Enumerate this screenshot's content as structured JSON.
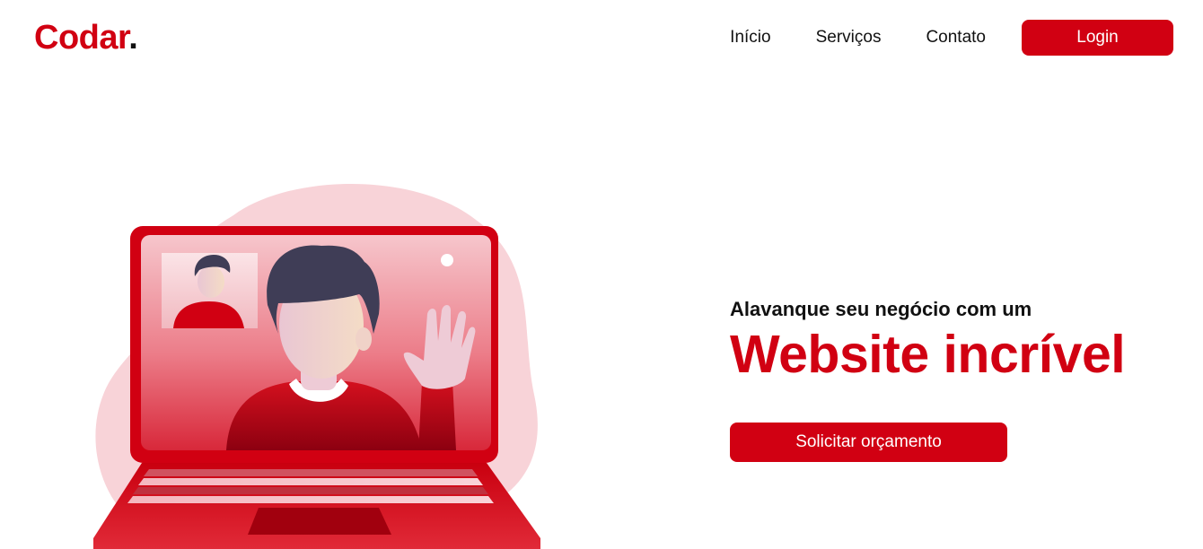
{
  "header": {
    "logo_text": "Codar",
    "logo_dot": ".",
    "nav": {
      "items": [
        {
          "label": "Início"
        },
        {
          "label": "Serviços"
        },
        {
          "label": "Contato"
        }
      ],
      "login_label": "Login"
    }
  },
  "hero": {
    "subtitle": "Alavanque seu negócio com um",
    "headline": "Website incrível",
    "cta_label": "Solicitar orçamento"
  },
  "colors": {
    "brand": "#d10012",
    "text": "#111111",
    "background": "#ffffff",
    "blob": "#f8d3d8"
  },
  "illustration": {
    "subject": "laptop-video-call-illustration"
  }
}
